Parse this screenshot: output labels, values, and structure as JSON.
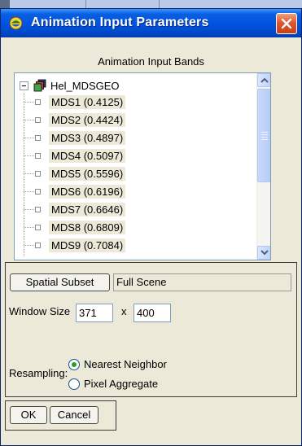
{
  "window": {
    "title": "Animation Input Parameters"
  },
  "bands": {
    "heading": "Animation Input Bands",
    "root": "Hel_MDSGEO",
    "items": [
      "MDS1 (0.4125)",
      "MDS2 (0.4424)",
      "MDS3 (0.4897)",
      "MDS4 (0.5097)",
      "MDS5 (0.5596)",
      "MDS6 (0.6196)",
      "MDS7 (0.6646)",
      "MDS8 (0.6809)",
      "MDS9 (0.7084)"
    ]
  },
  "subset": {
    "button_label": "Spatial Subset",
    "value": "Full Scene"
  },
  "window_size": {
    "label": "Window Size",
    "width": "371",
    "separator": "x",
    "height": "400"
  },
  "resampling": {
    "label": "Resampling:",
    "options": [
      "Nearest Neighbor",
      "Pixel Aggregate"
    ],
    "selected": "Nearest Neighbor"
  },
  "actions": {
    "ok_label": "OK",
    "cancel_label": "Cancel"
  },
  "icons": {
    "title": "envi-globe-icon",
    "close": "close-icon",
    "expander": "collapse-icon",
    "layer": "layer-stack-icon",
    "scroll_up": "arrow-up-icon",
    "scroll_down": "arrow-down-icon"
  },
  "colors": {
    "title_bar": "#0054e3",
    "close_button": "#e0582c",
    "dialog_bg": "#ece9d8",
    "radio_dot": "#21a121"
  }
}
